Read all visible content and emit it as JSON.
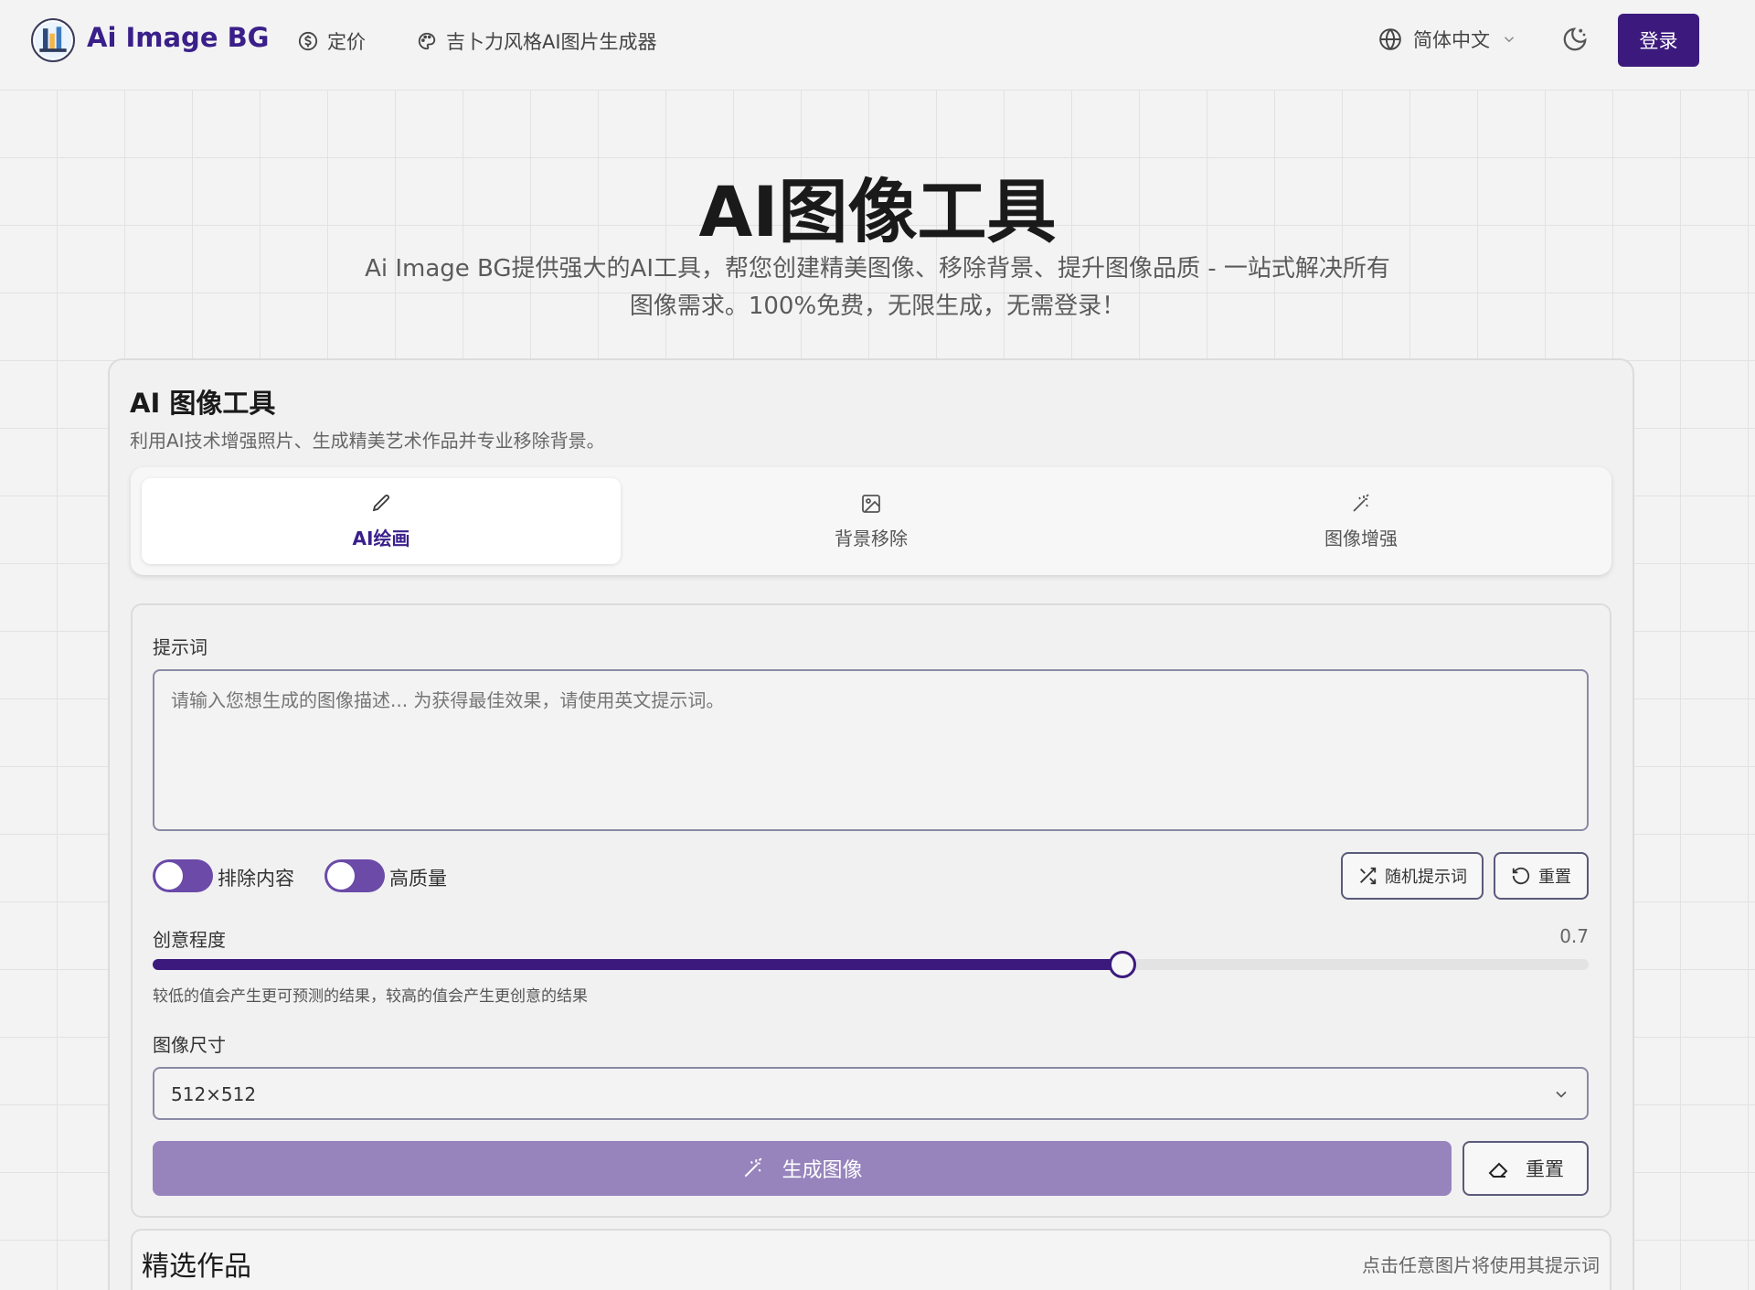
{
  "header": {
    "brand": "Ai Image BG",
    "nav": {
      "pricing": "定价",
      "ghibli": "吉卜力风格AI图片生成器"
    },
    "language": "简体中文",
    "login": "登录"
  },
  "hero": {
    "title": "AI图像工具",
    "subtitle": "Ai Image BG提供强大的AI工具，帮您创建精美图像、移除背景、提升图像品质 - 一站式解决所有图像需求。100%免费，无限生成，无需登录！"
  },
  "tool": {
    "title": "AI 图像工具",
    "description": "利用AI技术增强照片、生成精美艺术作品并专业移除背景。",
    "tabs": [
      {
        "label": "AI绘画",
        "icon": "pencil-icon",
        "active": true
      },
      {
        "label": "背景移除",
        "icon": "image-icon",
        "active": false
      },
      {
        "label": "图像增强",
        "icon": "wand-icon",
        "active": false
      }
    ]
  },
  "form": {
    "prompt_label": "提示词",
    "prompt_placeholder": "请输入您想生成的图像描述... 为获得最佳效果，请使用英文提示词。",
    "toggles": {
      "exclude": "排除内容",
      "hq": "高质量"
    },
    "random_prompt": "随机提示词",
    "reset": "重置",
    "creativity_label": "创意程度",
    "creativity_value": "0.7",
    "creativity_fraction": 0.7,
    "creativity_hint": "较低的值会产生更可预测的结果，较高的值会产生更创意的结果",
    "size_label": "图像尺寸",
    "size_value": "512×512",
    "generate": "生成图像",
    "reset2": "重置"
  },
  "featured": {
    "title": "精选作品",
    "hint": "点击任意图片将使用其提示词"
  },
  "colors": {
    "accent": "#3c1a7d",
    "generate_button": "#9784bd"
  }
}
